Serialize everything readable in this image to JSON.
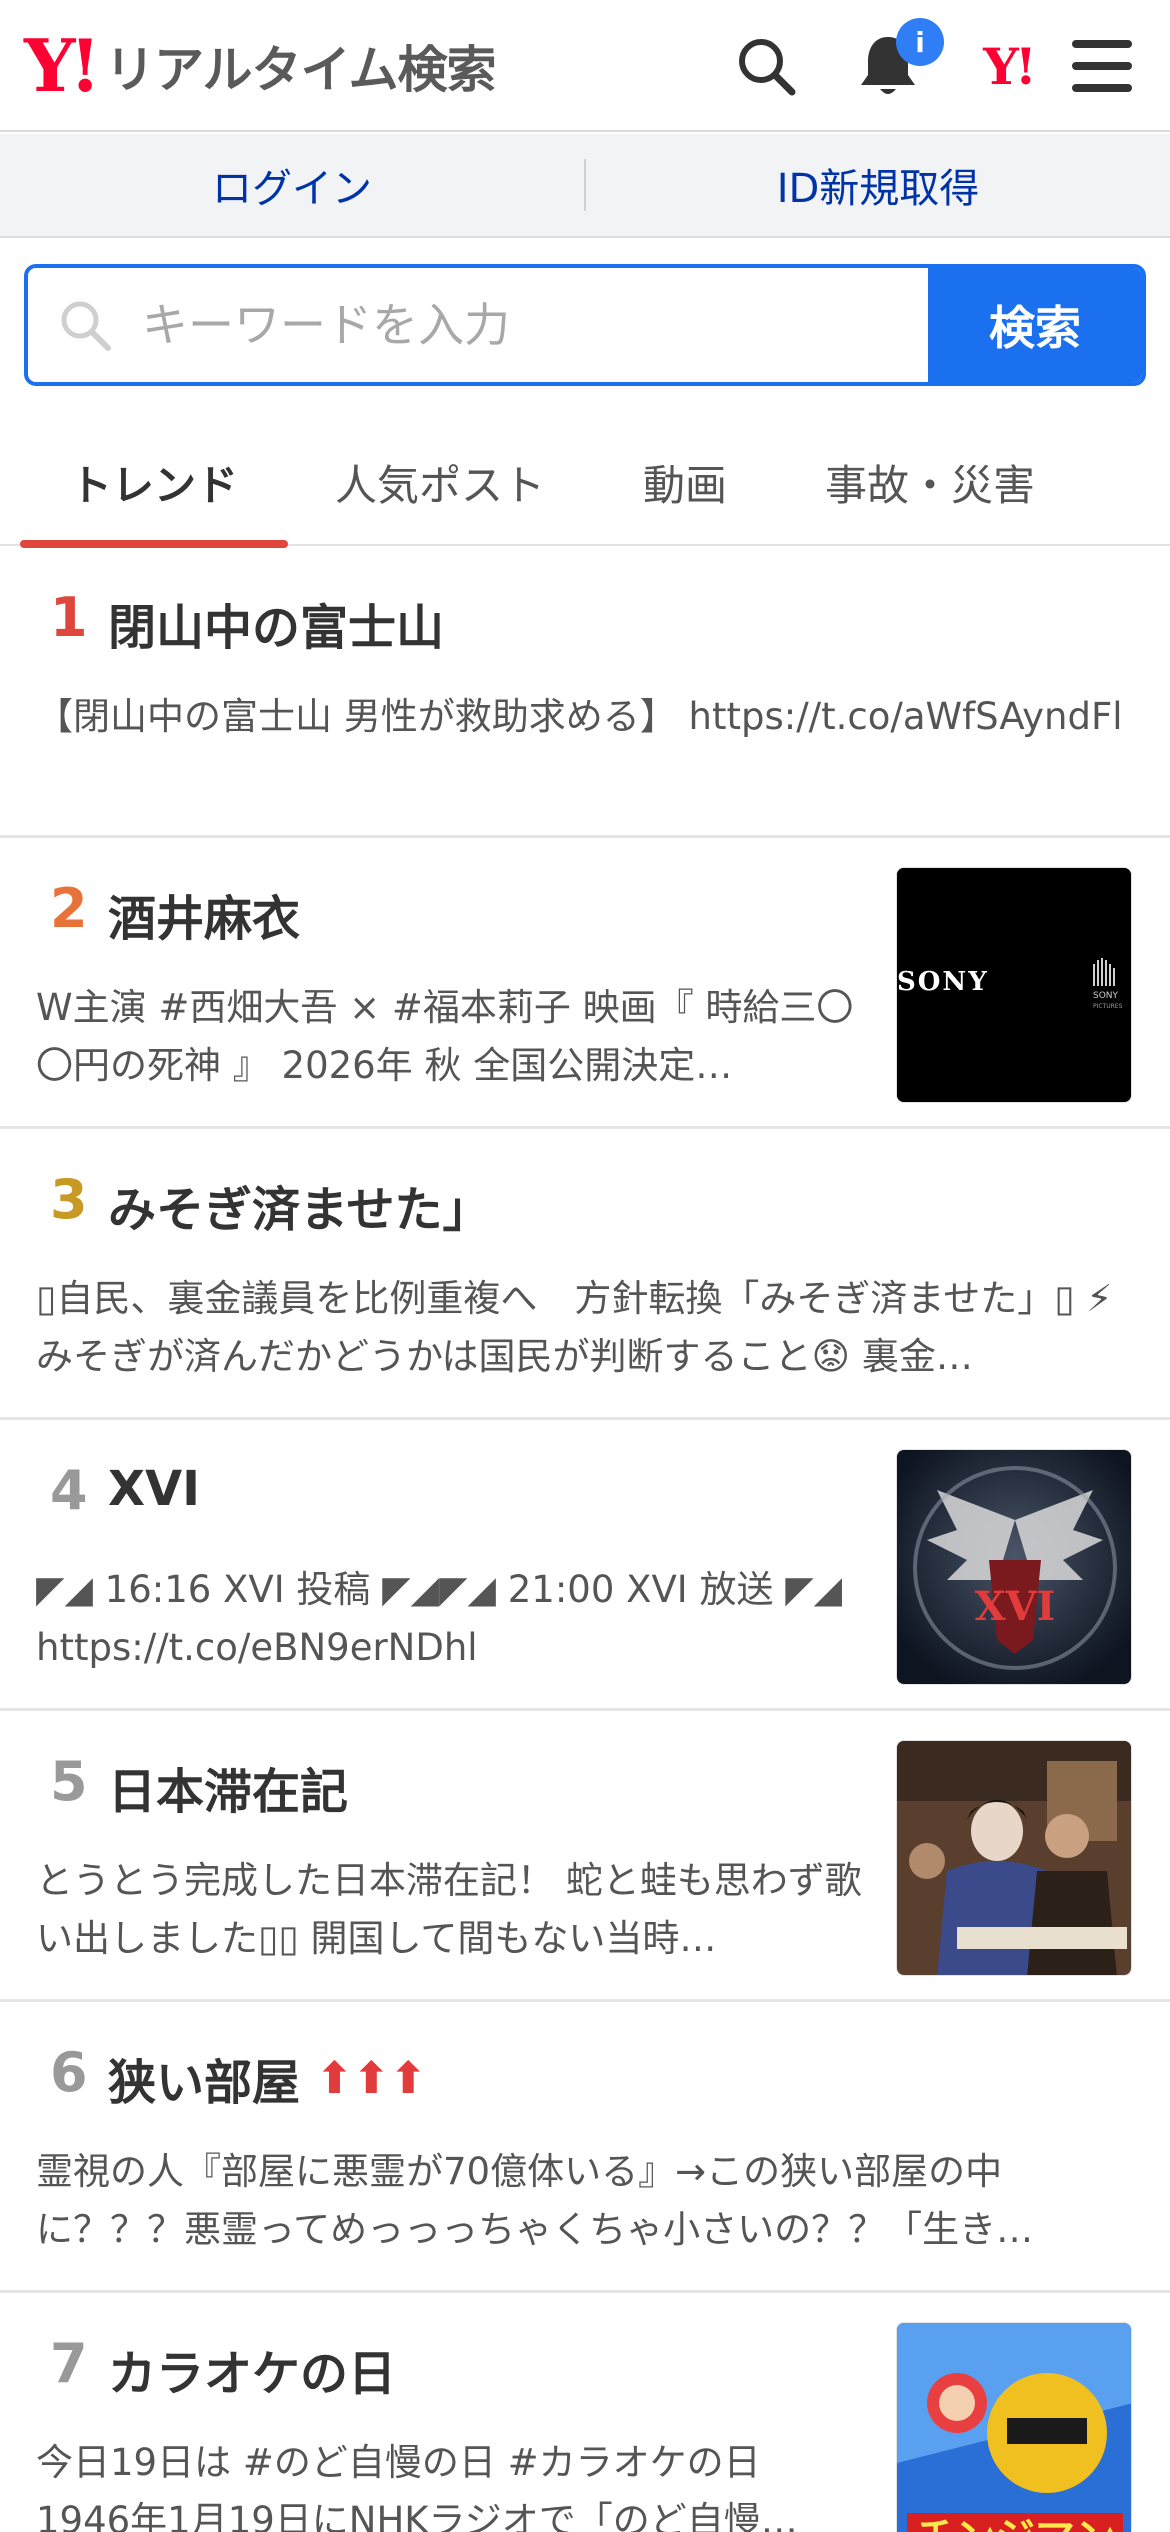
{
  "header": {
    "logo_mark": "Y!",
    "title": "リアルタイム検索",
    "notification_badge": "i",
    "yahoo_app_label": "Y!"
  },
  "account": {
    "login_label": "ログイン",
    "signup_label": "ID新規取得"
  },
  "search": {
    "placeholder": "キーワードを入力",
    "button_label": "検索"
  },
  "tabs": [
    {
      "label": "トレンド",
      "active": true
    },
    {
      "label": "人気ポスト",
      "active": false
    },
    {
      "label": "動画",
      "active": false
    },
    {
      "label": "事故・災害",
      "active": false
    }
  ],
  "trends": [
    {
      "rank": "1",
      "title": "閉山中の富士山",
      "desc": "【閉山中の富士山 男性が救助求める】 https://t.co/aWfSAyndFl",
      "rank_color": "#e0473c"
    },
    {
      "rank": "2",
      "title": "酒井麻衣",
      "desc": "W主演 #西畑大吾 × #福本莉子 映画『 時給三〇〇円の死神 』 2026年 秋 全国公開決定…",
      "rank_color": "#e8733a",
      "thumb": "sony-logo-image"
    },
    {
      "rank": "3",
      "title": "みそぎ済ませた」",
      "desc": "▯自民、裏金議員を比例重複へ　方針転換「みそぎ済ませた」▯ ⚡みそぎが済んだかどうかは国民が判断すること😟 裏金…",
      "rank_color": "#c99a23"
    },
    {
      "rank": "4",
      "title": "XVI",
      "desc": "◤◢ 16:16 XVI 投稿 ◤◢◤◢ 21:00 XVI 放送 ◤◢ https://t.co/eBN9erNDhl",
      "rank_color": "#999999",
      "thumb": "winged-emblem-image"
    },
    {
      "rank": "5",
      "title": "日本滞在記",
      "desc": "とうとう完成した日本滞在記！ 蛇と蛙も思わず歌い出しました▯▯ 開国して間もない当時…",
      "rank_color": "#999999",
      "thumb": "drama-scene-image"
    },
    {
      "rank": "6",
      "title": "狭い部屋",
      "desc": "霊視の人『部屋に悪霊が70億体いる』→この狭い部屋の中に？？？悪霊ってめっっっちゃくちゃ小さいの？？「生き…",
      "rank_color": "#999999",
      "trend_arrows": "⬆⬆⬆"
    },
    {
      "rank": "7",
      "title": "カラオケの日",
      "desc": "今日19日は #のど自慢の日 #カラオケの日 1946年1月19日にNHKラジオで「のど自慢…",
      "rank_color": "#999999",
      "thumb": "tokusatsu-poster-image",
      "thumb_text": "チンジマン"
    }
  ]
}
